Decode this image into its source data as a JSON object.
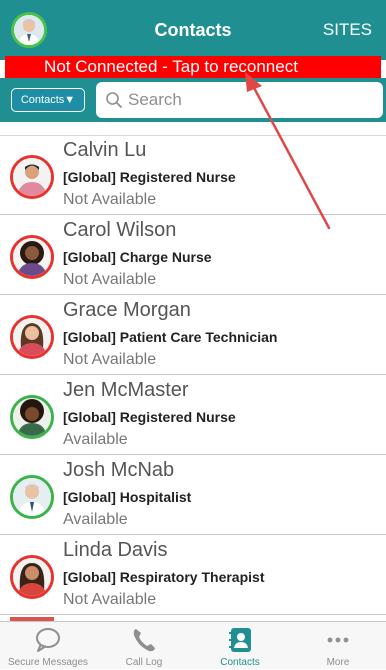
{
  "header": {
    "title": "Contacts",
    "sites_label": "SITES"
  },
  "banner": {
    "text": "Not Connected - Tap to reconnect"
  },
  "search": {
    "scope_label": "Contacts▼",
    "placeholder": "Search"
  },
  "contacts": [
    {
      "name": "Calvin Lu",
      "role": "[Global] Registered Nurse",
      "status": "Not Available"
    },
    {
      "name": "Carol Wilson",
      "role": "[Global] Charge Nurse",
      "status": "Not Available"
    },
    {
      "name": "Grace Morgan",
      "role": "[Global] Patient Care Technician",
      "status": "Not Available"
    },
    {
      "name": "Jen McMaster",
      "role": "[Global] Registered Nurse",
      "status": "Available"
    },
    {
      "name": "Josh McNab",
      "role": "[Global] Hospitalist",
      "status": "Available"
    },
    {
      "name": "Linda Davis",
      "role": "[Global] Respiratory Therapist",
      "status": "Not Available"
    }
  ],
  "tabbar": {
    "tabs": [
      {
        "label": "Secure Messages",
        "icon": "chat-bubble-icon"
      },
      {
        "label": "Call Log",
        "icon": "phone-icon"
      },
      {
        "label": "Contacts",
        "icon": "contacts-book-icon",
        "active": true
      },
      {
        "label": "More",
        "icon": "more-dots-icon"
      }
    ]
  },
  "colors": {
    "header_teal": "#1f8f91",
    "banner_red": "#ff0000",
    "available_green": "#3ab349",
    "unavailable_red": "#e8322b",
    "annotation_arrow": "#e04848"
  }
}
